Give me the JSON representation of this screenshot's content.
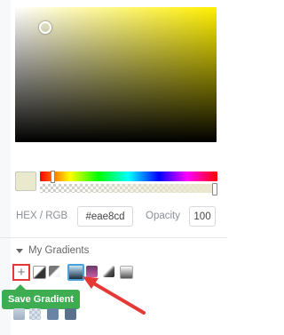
{
  "color_picker": {
    "hex_label": "HEX / RGB",
    "hex_value": "#eae8cd",
    "opacity_label": "Opacity",
    "opacity_value": "100",
    "current_color": "#eae8cd",
    "hue_color": "#fff000"
  },
  "gradients": {
    "section_title": "My Gradients",
    "add_button_icon": "plus-icon",
    "tooltip": "Save Gradient",
    "tooltip_color": "#3eac51",
    "highlight_color": "#e53935"
  }
}
